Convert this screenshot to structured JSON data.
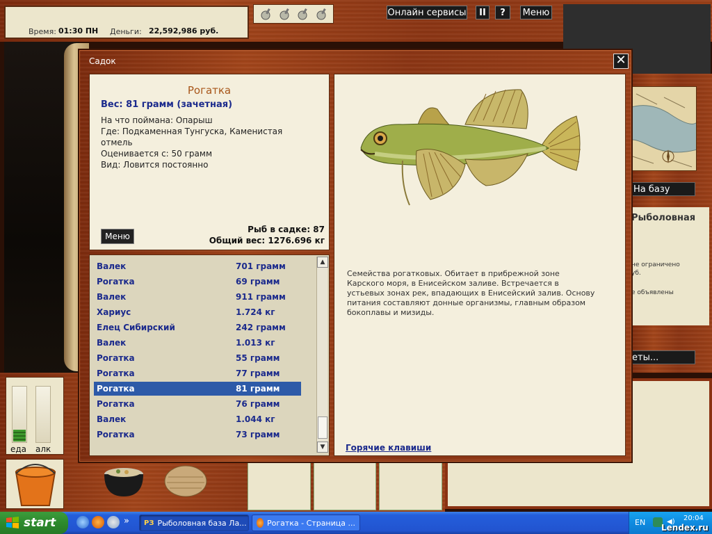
{
  "hud": {
    "time_label": "Время:",
    "time_value": "01:30 ПН",
    "money_label": "Деньги:",
    "money_value": "22,592,986 руб.",
    "online_services": "Онлайн сервисы",
    "pause": "II",
    "help": "?",
    "menu": "Меню"
  },
  "right_panel": {
    "na_bazu": "На базу",
    "info_title": "Рыболовная",
    "line1": "не ограничено",
    "line2": "уб.",
    "line3": "е объявлены",
    "ety_button": "еты..."
  },
  "meters": {
    "food_label": "еда",
    "alc_label": "алк",
    "food_level": 0.22,
    "alc_level": 0.0
  },
  "dialog": {
    "title": "Садок",
    "close": "✕",
    "fish": {
      "name": "Рогатка",
      "weight_line": "Вес: 81 грамм (зачетная)",
      "caught_on": "На что поймана: Опарыш",
      "where": "Где: Подкаменная Тунгуска, Каменистая отмель",
      "valued_from": "Оценивается с: 50 грамм",
      "kind": "Вид: Ловится постоянно",
      "description": "Семейства рогатковых. Обитает в прибрежной зоне Карского моря, в Енисейском заливе. Встречается в устьевых зонах рек, впадающих в Енисейский залив. Основу питания составляют донные организмы, главным образом бокоплавы и мизиды."
    },
    "menu_button": "Меню",
    "count_line": "Рыб в садке: 87",
    "total_line": "Общий вес: 1276.696 кг",
    "hotkeys": "Горячие клавиши",
    "catch": [
      {
        "name": "Валек",
        "weight": "701 грамм"
      },
      {
        "name": "Рогатка",
        "weight": "69 грамм"
      },
      {
        "name": "Валек",
        "weight": "911 грамм"
      },
      {
        "name": "Хариус",
        "weight": "1.724 кг"
      },
      {
        "name": "Елец Сибирский",
        "weight": "242 грамм"
      },
      {
        "name": "Валек",
        "weight": "1.013 кг"
      },
      {
        "name": "Рогатка",
        "weight": "55 грамм"
      },
      {
        "name": "Рогатка",
        "weight": "77 грамм"
      },
      {
        "name": "Рогатка",
        "weight": "81 грамм"
      },
      {
        "name": "Рогатка",
        "weight": "76 грамм"
      },
      {
        "name": "Валек",
        "weight": "1.044 кг"
      },
      {
        "name": "Рогатка",
        "weight": "73 грамм"
      }
    ],
    "selected_index": 8
  },
  "taskbar": {
    "start": "start",
    "task1": "Рыболовная база Ла...",
    "task2": "Рогатка - Страница ...",
    "lang": "EN",
    "clock": "20:04",
    "watermark": "Lendex.ru",
    "chevron": "»"
  },
  "colors": {
    "wood": "#8a3212",
    "panel": "#f4efdd",
    "link_blue": "#1b2a8c",
    "selection": "#2d5aa8",
    "fish_title": "#a8561a"
  }
}
